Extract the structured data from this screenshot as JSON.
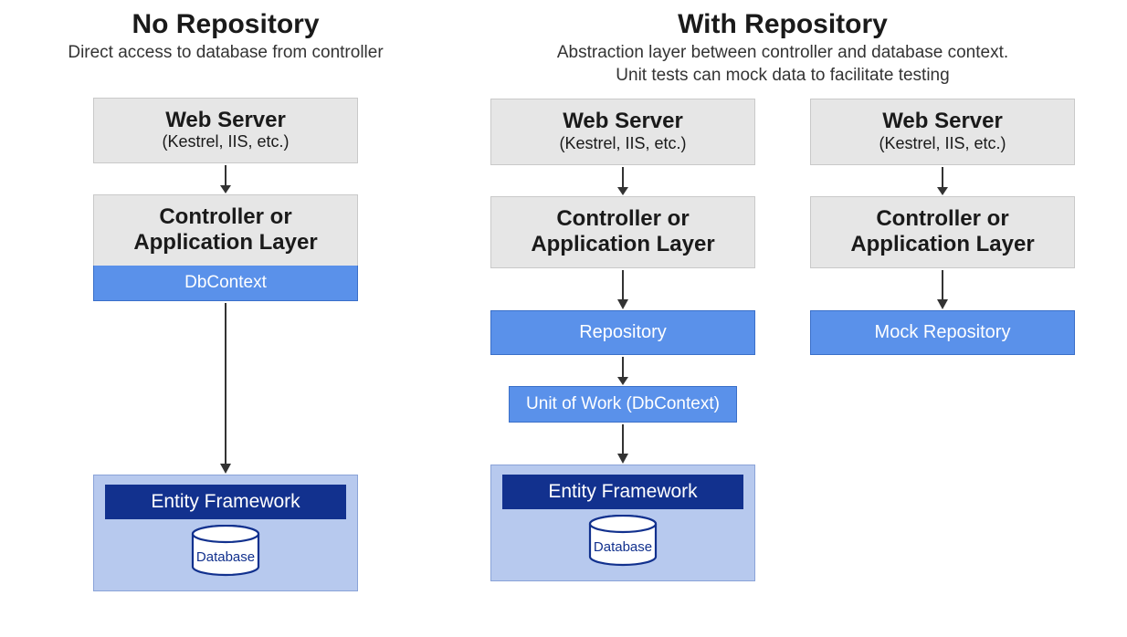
{
  "left": {
    "heading": "No Repository",
    "subheading": "Direct access to database from controller",
    "webserver_title": "Web Server",
    "webserver_sub": "(Kestrel, IIS, etc.)",
    "controller_line1": "Controller or",
    "controller_line2": "Application Layer",
    "dbcontext": "DbContext",
    "ef_title": "Entity Framework",
    "db_label": "Database"
  },
  "right": {
    "heading": "With Repository",
    "sub_line1": "Abstraction layer between controller and database context.",
    "sub_line2": "Unit tests can mock data to facilitate testing",
    "colA": {
      "webserver_title": "Web Server",
      "webserver_sub": "(Kestrel, IIS, etc.)",
      "controller_line1": "Controller or",
      "controller_line2": "Application Layer",
      "repository": "Repository",
      "uow": "Unit of Work (DbContext)",
      "ef_title": "Entity Framework",
      "db_label": "Database"
    },
    "colB": {
      "webserver_title": "Web Server",
      "webserver_sub": "(Kestrel, IIS, etc.)",
      "controller_line1": "Controller or",
      "controller_line2": "Application Layer",
      "mock_repo": "Mock Repository"
    }
  },
  "colors": {
    "gray_box": "#e6e6e6",
    "blue_box": "#5a91ea",
    "ef_bg": "#b7c9ee",
    "ef_title": "#12318e"
  }
}
